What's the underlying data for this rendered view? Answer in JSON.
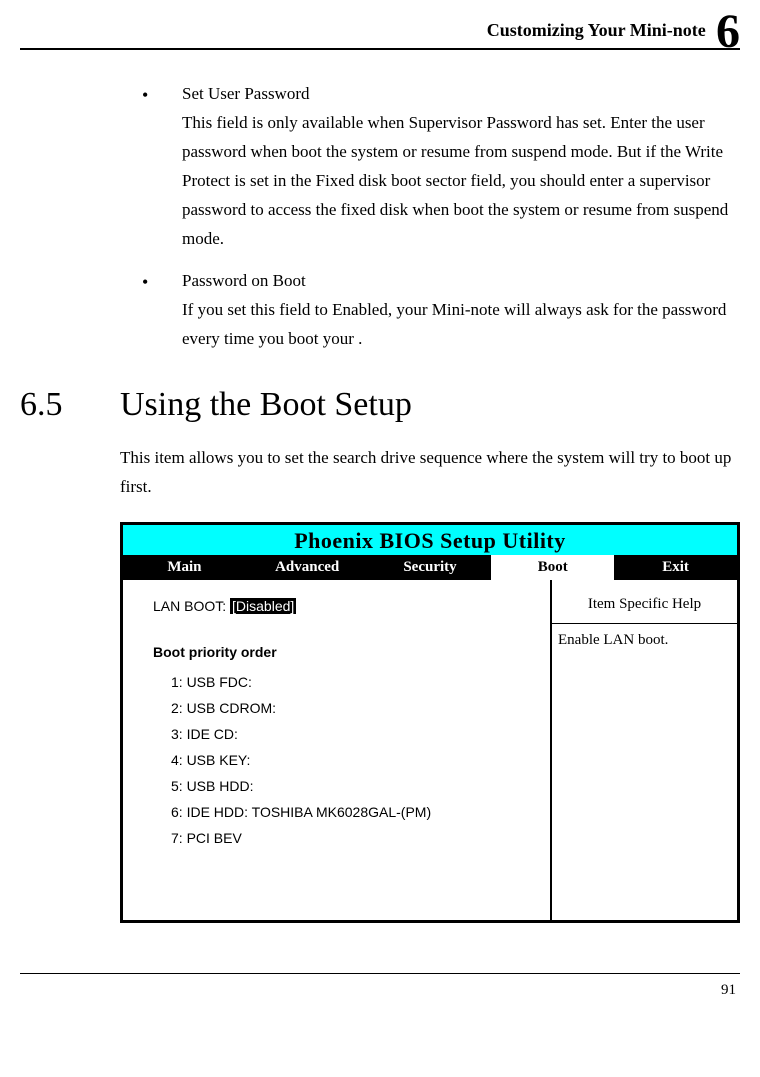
{
  "header": {
    "title": "Customizing Your Mini-note",
    "chapter": "6"
  },
  "bullets": [
    {
      "title": "Set User Password",
      "body": "This field is only available when Supervisor Password has set. Enter the user password when boot the system or resume from suspend mode. But if the Write Protect is set in the Fixed disk boot sector field, you should enter a supervisor password to access the fixed disk when boot the system or resume from suspend mode."
    },
    {
      "title": "Password on Boot",
      "body": "If you set this field to Enabled, your Mini-note will always ask for the password every time you boot your ."
    }
  ],
  "section": {
    "num": "6.5",
    "title": "Using the Boot Setup",
    "intro": "This item allows you to set the search drive sequence where the system will try to boot up first."
  },
  "bios": {
    "title": "Phoenix BIOS Setup Utility",
    "tabs": [
      "Main",
      "Advanced",
      "Security",
      "Boot",
      "Exit"
    ],
    "active_tab": "Boot",
    "lan_boot_label": "LAN BOOT:",
    "lan_boot_value": "[Disabled]",
    "boot_order_title": "Boot priority order",
    "boot_order": [
      "1: USB FDC:",
      "2: USB CDROM:",
      "3: IDE CD:",
      "4: USB KEY:",
      "5: USB HDD:",
      "6: IDE HDD: TOSHIBA MK6028GAL-(PM)",
      "7: PCI BEV"
    ],
    "help_title": "Item Specific Help",
    "help_body": "Enable LAN boot."
  },
  "page_number": "91"
}
